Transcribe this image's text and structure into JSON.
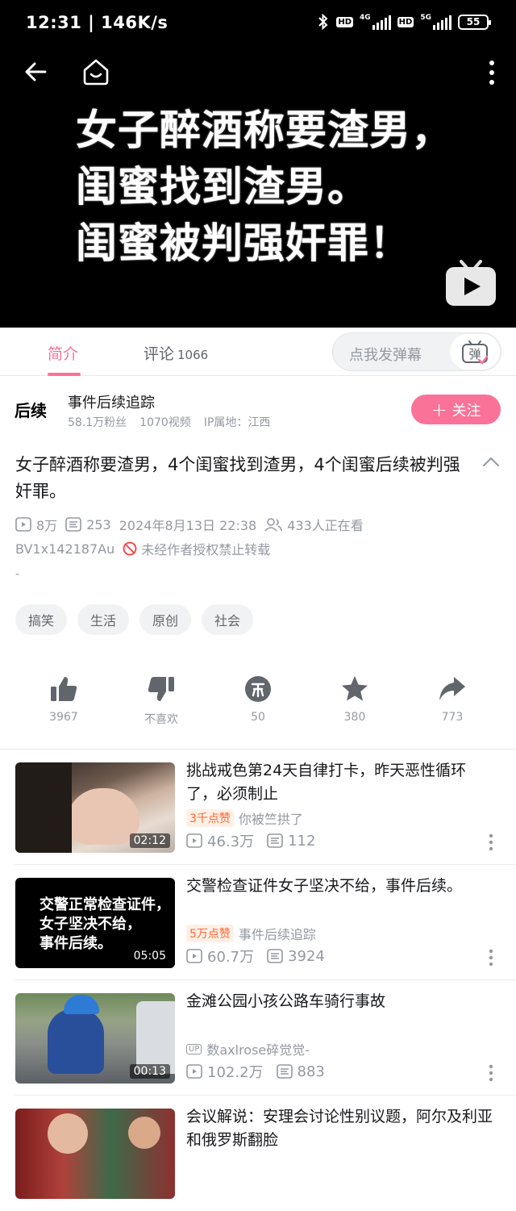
{
  "status_bar": {
    "time": "12:31 | 146K/s",
    "battery": "55",
    "net1": "4G",
    "net2": "5G",
    "hd": "HD"
  },
  "video": {
    "overlay_lines": [
      "女子醉酒称要渣男，",
      "闺蜜找到渣男。",
      "闺蜜被判强奸罪！"
    ]
  },
  "tabs": {
    "intro": "简介",
    "comments": "评论",
    "comments_count": "1066",
    "danmaku_placeholder": "点我发弹幕",
    "danmaku_icon_text": "弹"
  },
  "uploader": {
    "avatar_text": "后续",
    "name": "事件后续追踪",
    "fans": "58.1万粉丝",
    "videos": "1070视频",
    "ip": "IP属地：江西",
    "follow_label": "关注"
  },
  "video_info": {
    "title": "女子醉酒称要渣男，4个闺蜜找到渣男，4个闺蜜后续被判强奸罪。",
    "views": "8万",
    "danmaku": "253",
    "date": "2024年8月13日 22:38",
    "watching": "433人正在看",
    "bvid": "BV1x142187Au",
    "no_repost": "未经作者授权禁止转载",
    "description": "-",
    "tags": [
      "搞笑",
      "生活",
      "原创",
      "社会"
    ]
  },
  "actions": {
    "like": "3967",
    "dislike": "不喜欢",
    "coin": "50",
    "favorite": "380",
    "share": "773"
  },
  "related": [
    {
      "title": "挑战戒色第24天自律打卡，昨天恶性循环了，必须制止",
      "badge": "3千点赞",
      "author": "你被竺拱了",
      "views": "46.3万",
      "danmaku": "112",
      "duration": "02:12"
    },
    {
      "title": "交警检查证件女子坚决不给，事件后续。",
      "badge": "5万点赞",
      "author": "事件后续追踪",
      "views": "60.7万",
      "danmaku": "3924",
      "duration": "05:05",
      "thumb_text": [
        "交警正常检查证件，",
        "女子坚决不给，",
        "事件后续。"
      ]
    },
    {
      "title": "金滩公园小孩公路车骑行事故",
      "up_badge": "UP",
      "author": "数axlrose碎觉觉-",
      "views": "102.2万",
      "danmaku": "883",
      "duration": "00:13"
    },
    {
      "title": "会议解说：安理会讨论性别议题，阿尔及利亚和俄罗斯翻脸"
    }
  ],
  "colors": {
    "accent": "#fb7299",
    "text": "#18191c",
    "muted": "#9499a0",
    "orange": "#ff6633"
  },
  "icons": [
    "back-arrow-icon",
    "home-tv-icon",
    "more-vertical-icon",
    "bilibili-tv-icon",
    "danmaku-icon",
    "plus-icon",
    "chevron-up-icon",
    "play-count-icon",
    "danmaku-count-icon",
    "watching-icon",
    "no-repost-icon",
    "thumbs-up-icon",
    "thumbs-down-icon",
    "coin-icon",
    "star-icon",
    "share-icon"
  ]
}
